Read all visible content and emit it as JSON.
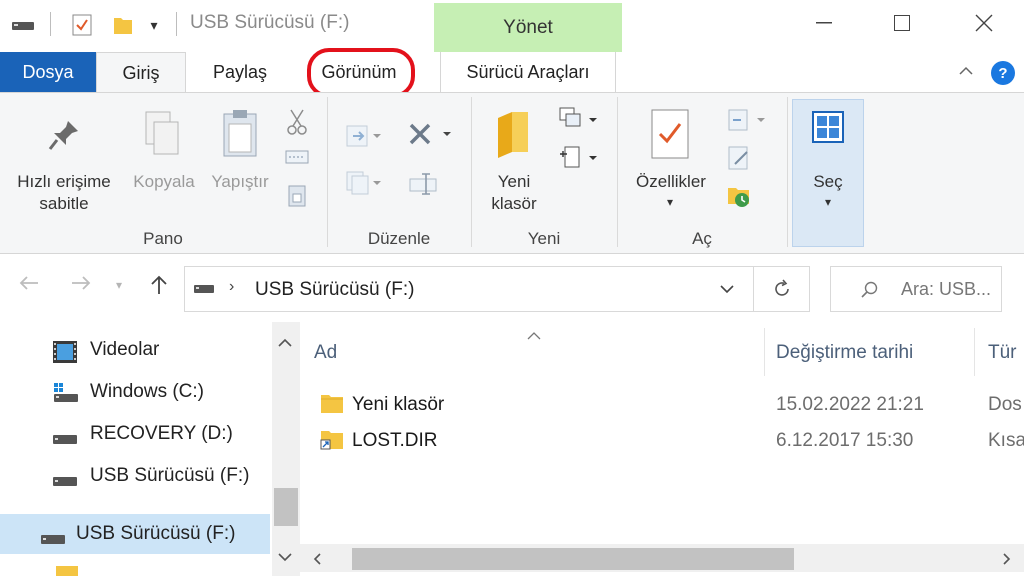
{
  "window": {
    "title": "USB Sürücüsü (F:)",
    "context_tab_group": "Yönet",
    "accent": "#1a63b8",
    "context_color": "#c6efb4",
    "highlight_color": "#e3111b"
  },
  "tabs": {
    "file": "Dosya",
    "home": "Giriş",
    "share": "Paylaş",
    "view": "Görünüm",
    "drive_tools": "Sürücü Araçları"
  },
  "ribbon": {
    "pano": {
      "label": "Pano",
      "pin_line1": "Hızlı erişime",
      "pin_line2": "sabitle",
      "copy": "Kopyala",
      "paste": "Yapıştır"
    },
    "organize": {
      "label": "Düzenle"
    },
    "new": {
      "label": "Yeni",
      "new_folder_line1": "Yeni",
      "new_folder_line2": "klasör"
    },
    "open": {
      "label": "Aç",
      "properties": "Özellikler"
    },
    "select": {
      "label": "Seç"
    }
  },
  "address": {
    "path": "USB Sürücüsü (F:)",
    "search_placeholder": "Ara: USB..."
  },
  "navpane": {
    "items": [
      {
        "label": "Videolar",
        "icon": "video-folder-icon"
      },
      {
        "label": "Windows (C:)",
        "icon": "windows-drive-icon"
      },
      {
        "label": "RECOVERY (D:)",
        "icon": "drive-icon"
      },
      {
        "label": "USB Sürücüsü (F:)",
        "icon": "usb-drive-icon"
      },
      {
        "label": "USB Sürücüsü (F:)",
        "icon": "usb-drive-icon",
        "selected": true
      }
    ]
  },
  "content": {
    "columns": {
      "name": "Ad",
      "modified": "Değiştirme tarihi",
      "type": "Tür"
    },
    "rows": [
      {
        "name": "Yeni klasör",
        "modified": "15.02.2022 21:21",
        "type": "Dos",
        "icon": "folder-icon"
      },
      {
        "name": "LOST.DIR",
        "modified": "6.12.2017 15:30",
        "type": "Kısa",
        "icon": "shortcut-folder-icon"
      }
    ]
  }
}
